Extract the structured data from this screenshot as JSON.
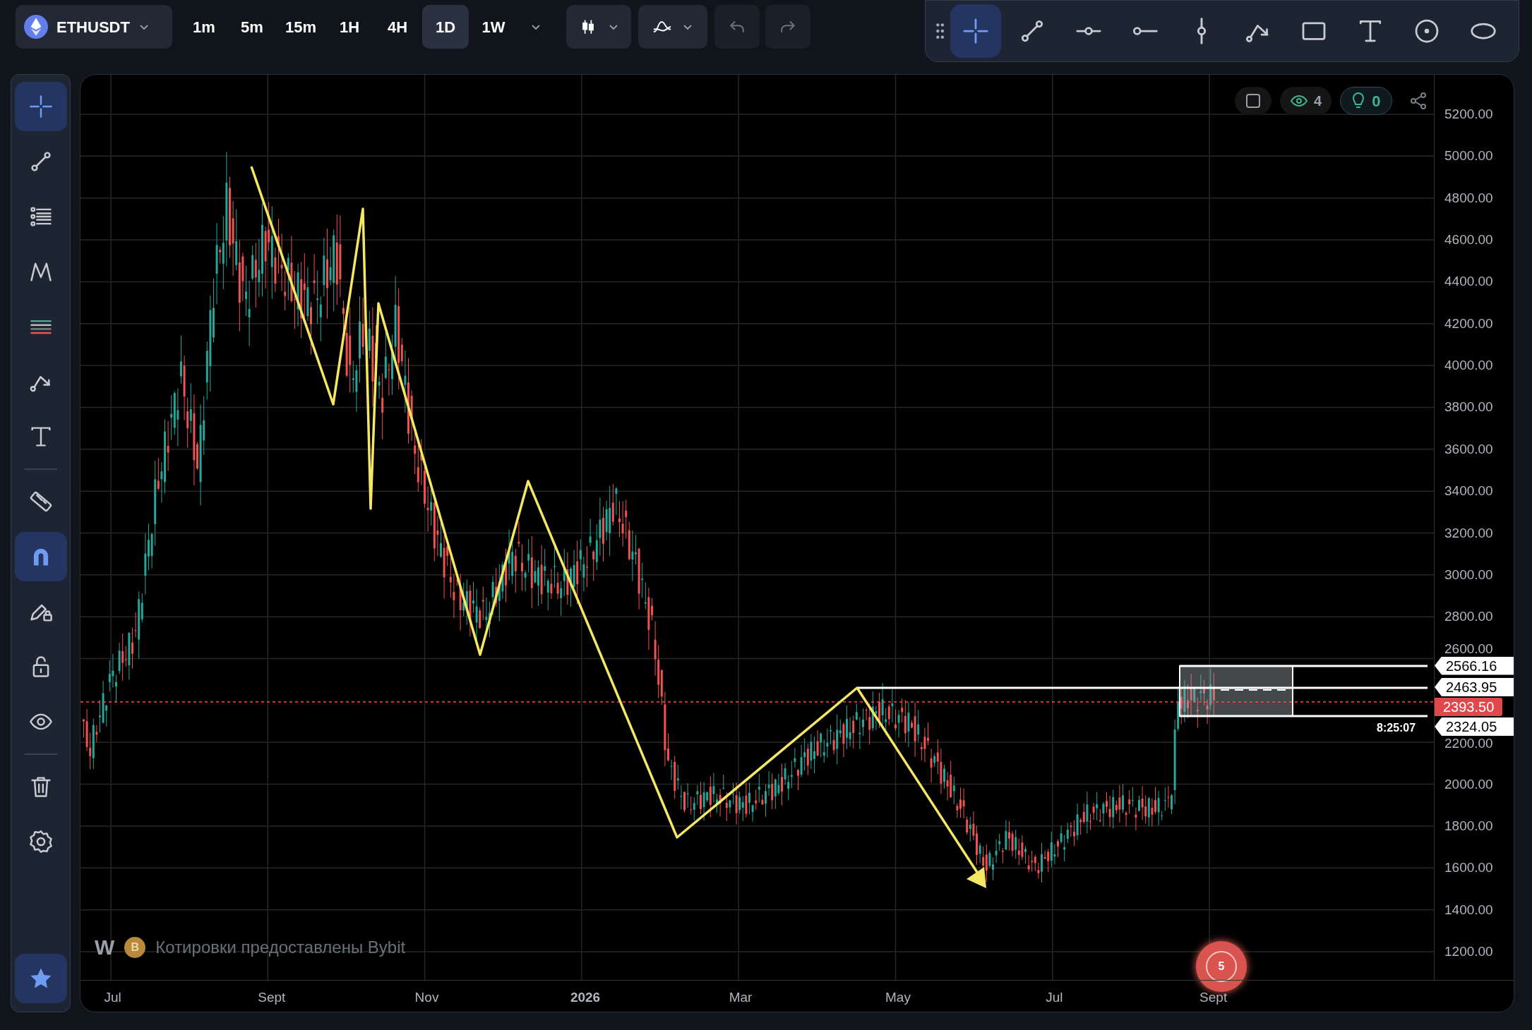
{
  "symbol": {
    "ticker": "ETHUSDT"
  },
  "timeframes": [
    {
      "label": "1m",
      "selected": false
    },
    {
      "label": "5m",
      "selected": false
    },
    {
      "label": "15m",
      "selected": false
    },
    {
      "label": "1H",
      "selected": false
    },
    {
      "label": "4H",
      "selected": false
    },
    {
      "label": "1D",
      "selected": true
    },
    {
      "label": "1W",
      "selected": false
    }
  ],
  "drawing_toolbar": {
    "tools": [
      {
        "kind": "crosshair",
        "selected": true
      },
      {
        "kind": "trend",
        "selected": false
      },
      {
        "kind": "hline",
        "selected": false
      },
      {
        "kind": "ray",
        "selected": false
      },
      {
        "kind": "vline",
        "selected": false
      },
      {
        "kind": "path",
        "selected": false
      },
      {
        "kind": "rect",
        "selected": false
      },
      {
        "kind": "text",
        "selected": false
      },
      {
        "kind": "circle",
        "selected": false
      },
      {
        "kind": "ellipse",
        "selected": false
      }
    ]
  },
  "left_toolbar": {
    "tools": [
      {
        "kind": "crosshair",
        "selected": true
      },
      {
        "kind": "trend",
        "selected": false
      },
      {
        "kind": "fib",
        "selected": false
      },
      {
        "kind": "pattern",
        "selected": false
      },
      {
        "kind": "channel",
        "selected": false
      },
      {
        "kind": "path",
        "selected": false
      },
      {
        "kind": "text",
        "selected": false
      },
      {
        "kind": "divider"
      },
      {
        "kind": "ruler",
        "selected": false
      },
      {
        "kind": "magnet",
        "selected": true
      },
      {
        "kind": "brush",
        "selected": false
      },
      {
        "kind": "lock",
        "selected": false
      },
      {
        "kind": "eye",
        "selected": false
      },
      {
        "kind": "divider"
      },
      {
        "kind": "trash",
        "selected": false
      },
      {
        "kind": "settings",
        "selected": false
      },
      {
        "kind": "star",
        "selected": true
      }
    ]
  },
  "chart_overlay": {
    "visible_count": "4",
    "ideas_count": "0"
  },
  "price_scale": [
    "5200.00",
    "5000.00",
    "4800.00",
    "4600.00",
    "4400.00",
    "4200.00",
    "4000.00",
    "3800.00",
    "3600.00",
    "3400.00",
    "3200.00",
    "3000.00",
    "2800.00",
    "2600.00",
    "2200.00",
    "2000.00",
    "1800.00",
    "1600.00",
    "1400.00",
    "1200.00"
  ],
  "price_tags": [
    {
      "value": "2566.16",
      "kind": "level"
    },
    {
      "value": "2463.95",
      "kind": "level"
    },
    {
      "value": "2393.50",
      "kind": "last"
    },
    {
      "value": "2324.05",
      "kind": "level"
    }
  ],
  "countdown": "8:25:07",
  "time_scale": [
    {
      "label": "Jul",
      "bold": false
    },
    {
      "label": "Sept",
      "bold": false
    },
    {
      "label": "Nov",
      "bold": false
    },
    {
      "label": "2026",
      "bold": true
    },
    {
      "label": "Mar",
      "bold": false
    },
    {
      "label": "May",
      "bold": false
    },
    {
      "label": "Jul",
      "bold": false
    },
    {
      "label": "Sept",
      "bold": false
    }
  ],
  "attribution": {
    "logo": "W",
    "exchange_initial": "B",
    "text": "Котировки предоставлены Bybit"
  },
  "notification_badge": "5"
}
